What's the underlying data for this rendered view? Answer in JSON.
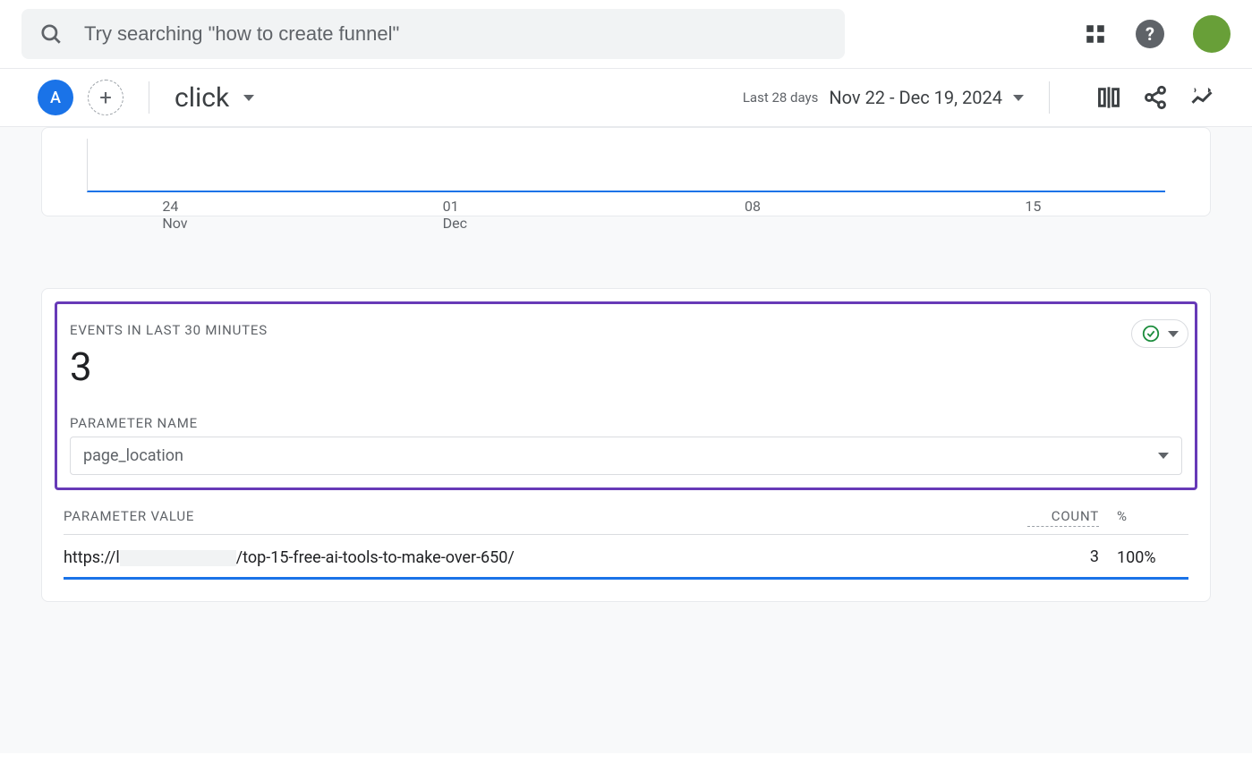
{
  "search": {
    "placeholder": "Try searching \"how to create funnel\""
  },
  "toolbar": {
    "chip_label": "A",
    "event_name": "click",
    "date_label": "Last 28 days",
    "date_range": "Nov 22 - Dec 19, 2024"
  },
  "chart_data": {
    "type": "line",
    "title": "",
    "x_ticks": [
      {
        "day": "24",
        "month": "Nov"
      },
      {
        "day": "01",
        "month": "Dec"
      },
      {
        "day": "08",
        "month": ""
      },
      {
        "day": "15",
        "month": ""
      }
    ]
  },
  "events_card": {
    "title": "EVENTS IN LAST 30 MINUTES",
    "count": "3",
    "param_label": "PARAMETER NAME",
    "param_selected": "page_location",
    "table": {
      "headers": {
        "value": "PARAMETER VALUE",
        "count": "COUNT",
        "pct": "%"
      },
      "rows": [
        {
          "value_prefix": "https://l",
          "value_suffix": "/top-15-free-ai-tools-to-make-over-650/",
          "count": "3",
          "pct": "100%"
        }
      ]
    }
  }
}
